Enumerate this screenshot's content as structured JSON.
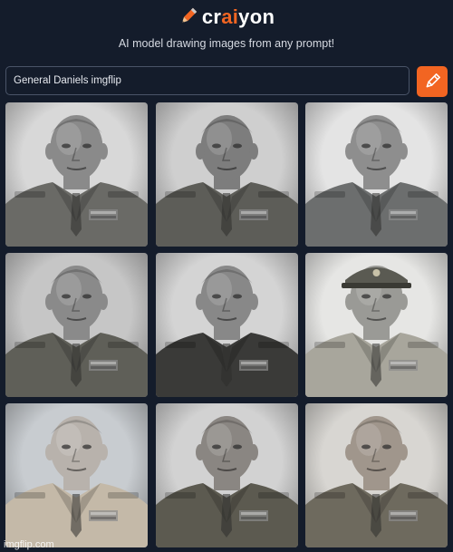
{
  "app": {
    "logo_prefix": "cr",
    "logo_accent": "ai",
    "logo_suffix": "yon",
    "tagline": "AI model drawing images from any prompt!",
    "accent_color": "#f26522",
    "background_color": "#141c2b"
  },
  "prompt": {
    "value": "General Daniels imgflip"
  },
  "draw_button": {
    "icon": "pencil-icon"
  },
  "results": [
    {
      "name": "generated-image-1",
      "bg": "#d8d8d8",
      "tone": "#8a8a8a",
      "uniform": "#6a6a66",
      "hat": false
    },
    {
      "name": "generated-image-2",
      "bg": "#cfcfcf",
      "tone": "#7d7d7d",
      "uniform": "#5d5d58",
      "hat": false
    },
    {
      "name": "generated-image-3",
      "bg": "#e4e4e4",
      "tone": "#8e8e8e",
      "uniform": "#6c6e6e",
      "hat": false
    },
    {
      "name": "generated-image-4",
      "bg": "#c6c6c6",
      "tone": "#8a8a8a",
      "uniform": "#5f5f58",
      "hat": false
    },
    {
      "name": "generated-image-5",
      "bg": "#d4d4d4",
      "tone": "#888888",
      "uniform": "#3a3a38",
      "hat": false
    },
    {
      "name": "generated-image-6",
      "bg": "#e6e6e4",
      "tone": "#9a9a96",
      "uniform": "#a8a69c",
      "hat": true
    },
    {
      "name": "generated-image-7",
      "bg": "#c8ccd0",
      "tone": "#b8b2ac",
      "uniform": "#c4b9a8",
      "hat": false
    },
    {
      "name": "generated-image-8",
      "bg": "#d2d2d2",
      "tone": "#8a8682",
      "uniform": "#5c5a50",
      "hat": false
    },
    {
      "name": "generated-image-9",
      "bg": "#d8d6d2",
      "tone": "#a0968c",
      "uniform": "#6e6a5e",
      "hat": false
    }
  ],
  "watermark": "imgflip.com"
}
